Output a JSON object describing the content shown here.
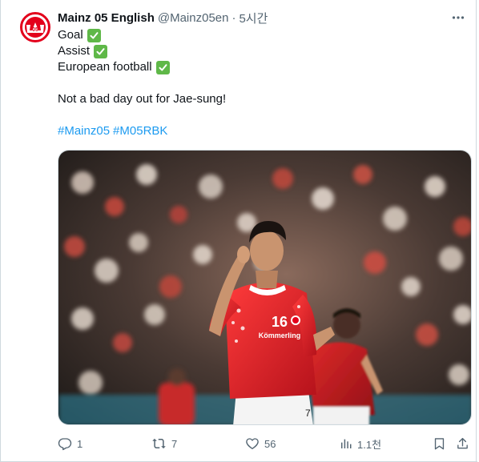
{
  "tweet": {
    "display_name": "Mainz 05 English",
    "handle": "@Mainz05en",
    "separator": "·",
    "time": "5시간",
    "lines": [
      "Goal",
      "Assist",
      "European football"
    ],
    "message": "Not a bad day out for Jae-sung!",
    "hashtags": [
      "#Mainz05",
      "#M05RBK"
    ]
  },
  "actions": {
    "replies": "1",
    "reposts": "7",
    "likes": "56",
    "views": "1.1천"
  },
  "media": {
    "jersey_sponsor": "Kömmerling"
  },
  "colors": {
    "brand_red": "#e3001b",
    "link_blue": "#1d9bf0",
    "secondary_text": "#536471",
    "check_green": "#5fb848"
  },
  "icons": [
    "more-icon",
    "reply-icon",
    "repost-icon",
    "like-icon",
    "views-icon",
    "bookmark-icon",
    "share-icon",
    "check-emoji-icon"
  ]
}
